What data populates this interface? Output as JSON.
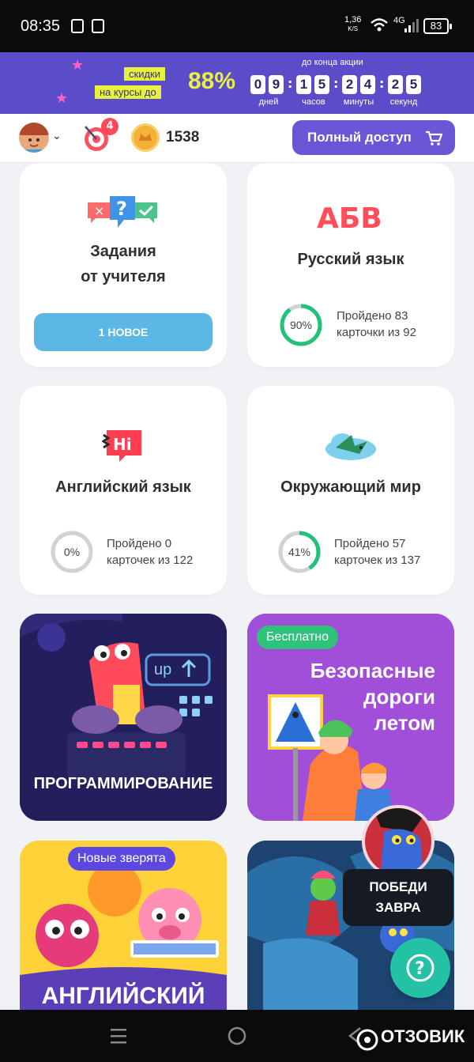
{
  "status_bar": {
    "time": "08:35",
    "speed_value": "1,36",
    "speed_unit": "K/S",
    "network": "4G",
    "battery": "83"
  },
  "promo": {
    "tag_line1": "скидки",
    "tag_line2": "на курсы до",
    "percent": "88%",
    "until_label": "до конца акции",
    "digits": [
      "0",
      "9",
      "1",
      "5",
      "2",
      "4",
      "2",
      "5"
    ],
    "units": [
      "дней",
      "часов",
      "минуты",
      "секунд"
    ]
  },
  "topnav": {
    "badge_count": "4",
    "coins": "1538",
    "full_access_label": "Полный доступ"
  },
  "cards": {
    "teacher": {
      "title_line1": "Задания",
      "title_line2": "от учителя",
      "button": "1 НОВОЕ"
    },
    "russian": {
      "logo": "АБВ",
      "title": "Русский язык",
      "progress": 90,
      "progress_label": "90%",
      "text1": "Пройдено 83",
      "text2": "карточки из 92"
    },
    "english": {
      "logo": "Hi",
      "title": "Английский язык",
      "progress": 0,
      "progress_label": "0%",
      "text1": "Пройдено 0",
      "text2": "карточек из 122"
    },
    "world": {
      "title": "Окружающий мир",
      "progress": 41,
      "progress_label": "41%",
      "text1": "Пройдено 57",
      "text2": "карточек из 137"
    }
  },
  "promo_cards": {
    "programming": {
      "title": "ПРОГРАММИРОВАНИЕ",
      "sign": "up"
    },
    "roads": {
      "badge": "Бесплатно",
      "line1": "Безопасные",
      "line2": "дороги",
      "line3": "летом"
    },
    "animals": {
      "badge": "Новые зверята",
      "title": "АНГЛИЙСКИЙ"
    }
  },
  "floating": {
    "win_line1": "ПОБЕДИ",
    "win_line2": "ЗАВРА",
    "help_icon": "?"
  },
  "watermark": "ОТЗОВИК",
  "colors": {
    "accent": "#6a56d6",
    "progress_green": "#22c27a",
    "progress_track": "#cfd2d6",
    "new_button": "#5bb8e5",
    "help": "#23c2a4"
  }
}
